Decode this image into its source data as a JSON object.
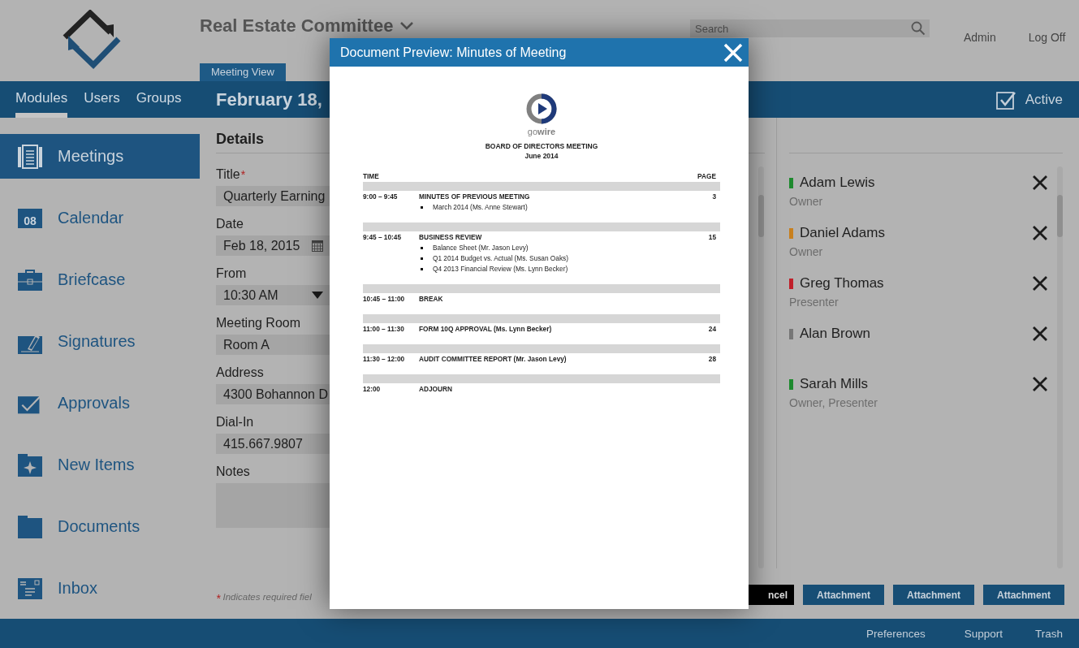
{
  "header": {
    "committee": "Real Estate Committee",
    "search": {
      "placeholder": "Search"
    },
    "links": [
      "Admin",
      "Log Off"
    ]
  },
  "nav": {
    "tabs": [
      {
        "label": "Modules",
        "selected": true
      },
      {
        "label": "Users",
        "selected": false
      },
      {
        "label": "Groups",
        "selected": false
      }
    ],
    "view_tab": "Meeting View",
    "date_heading": "February 18,",
    "active": {
      "label": "Active",
      "checked": true
    }
  },
  "sidebar": {
    "items": [
      {
        "label": "Meetings",
        "selected": true
      },
      {
        "label": "Calendar",
        "selected": false,
        "icon_text": "08"
      },
      {
        "label": "Briefcase",
        "selected": false
      },
      {
        "label": "Signatures",
        "selected": false
      },
      {
        "label": "Approvals",
        "selected": false
      },
      {
        "label": "New Items",
        "selected": false
      },
      {
        "label": "Documents",
        "selected": false
      },
      {
        "label": "Inbox",
        "selected": false
      }
    ]
  },
  "details": {
    "heading": "Details",
    "fields": [
      {
        "label": "Title",
        "mark": "*",
        "kind": "text",
        "value": "Quarterly Earning"
      },
      {
        "label": "Date",
        "kind": "date",
        "value": "Feb 18, 2015"
      },
      {
        "label": "From",
        "kind": "select",
        "value": "10:30 AM"
      },
      {
        "label": "Meeting Room",
        "kind": "text",
        "value": "Room A"
      },
      {
        "label": "Address",
        "kind": "text",
        "value": "4300 Bohannon D"
      },
      {
        "label": "Dial-In",
        "kind": "text",
        "value": "415.667.9807"
      },
      {
        "label": "Notes",
        "kind": "textarea"
      }
    ],
    "footnote_mark": "*",
    "footnote": "Indicates required fiel"
  },
  "attendees": [
    {
      "name": "Adam Lewis",
      "role": "Owner",
      "color": "#1e8a2e"
    },
    {
      "name": "Daniel Adams",
      "role": "Owner",
      "color": "#c8801e"
    },
    {
      "name": "Greg Thomas",
      "role": "Presenter",
      "color": "#c0202a"
    },
    {
      "name": "Alan Brown",
      "color": "#777777"
    },
    {
      "name": "Sarah Mills",
      "role": "Owner, Presenter",
      "color": "#1e8a2e"
    }
  ],
  "buttons": [
    {
      "label": "ncel",
      "kind": "cancel"
    },
    {
      "label": "Attachment",
      "kind": "primary"
    },
    {
      "label": "Attachment",
      "kind": "primary"
    },
    {
      "label": "Attachment",
      "kind": "primary"
    }
  ],
  "footer": {
    "links": [
      "Preferences",
      "Support",
      "Trash"
    ]
  },
  "dialog": {
    "title": "Document Preview: Minutes of Meeting",
    "document": {
      "brand": "go**wire**",
      "title": "BOARD OF DIRECTORS MEETING",
      "subtitle": "June 2014",
      "columns": [
        "TIME",
        "PAGE"
      ],
      "rows": [
        {
          "time": "9:00 – 9:45",
          "item": "MINUTES OF PREVIOUS MEETING",
          "page": "3",
          "bullets": [
            "March 2014  (Ms. Anne Stewart)"
          ]
        },
        {
          "time": "9:45 – 10:45",
          "item": "BUSINESS REVIEW",
          "page": "15",
          "bullets": [
            "Balance Sheet  (Mr. Jason Levy)",
            "Q1 2014 Budget vs. Actual  (Ms. Susan Oaks)",
            "Q4 2013 Financial Review  (Ms. Lynn Becker)"
          ]
        },
        {
          "time": "10:45 – 11:00",
          "item": "BREAK"
        },
        {
          "time": "11:00 – 11:30",
          "item": "FORM 10Q APPROVAL  (Ms. Lynn Becker)",
          "page": "24"
        },
        {
          "time": "11:30 – 12:00",
          "item": "AUDIT COMMITTEE REPORT  (Mr. Jason Levy)",
          "page": "28"
        },
        {
          "time": "12:00",
          "item": "ADJOURN"
        }
      ]
    }
  }
}
